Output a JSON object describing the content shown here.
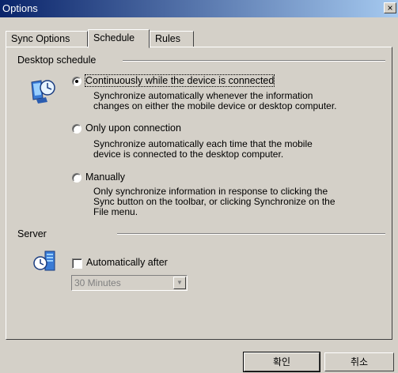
{
  "window": {
    "title": "Options"
  },
  "tabs": [
    {
      "label": "Sync Options"
    },
    {
      "label": "Schedule"
    },
    {
      "label": "Rules"
    }
  ],
  "desktop_schedule": {
    "heading": "Desktop schedule",
    "options": [
      {
        "label": "Continuously while the device is connected",
        "selected": true,
        "description": [
          "Synchronize automatically whenever the information",
          "changes on either the mobile device or desktop computer."
        ]
      },
      {
        "label": "Only upon connection",
        "selected": false,
        "description": [
          "Synchronize automatically each time that the mobile",
          "device is connected to the desktop computer."
        ]
      },
      {
        "label": "Manually",
        "selected": false,
        "description": [
          "Only synchronize information in response to clicking the",
          "Sync button on the toolbar, or clicking Synchronize on the",
          "File menu."
        ]
      }
    ]
  },
  "server": {
    "heading": "Server",
    "auto_label": "Automatically after",
    "auto_checked": false,
    "interval_value": "30 Minutes"
  },
  "buttons": {
    "ok": "확인",
    "cancel": "취소"
  },
  "icons": {
    "sync_icon": "sync-computer-icon",
    "server_icon": "server-clock-icon"
  }
}
